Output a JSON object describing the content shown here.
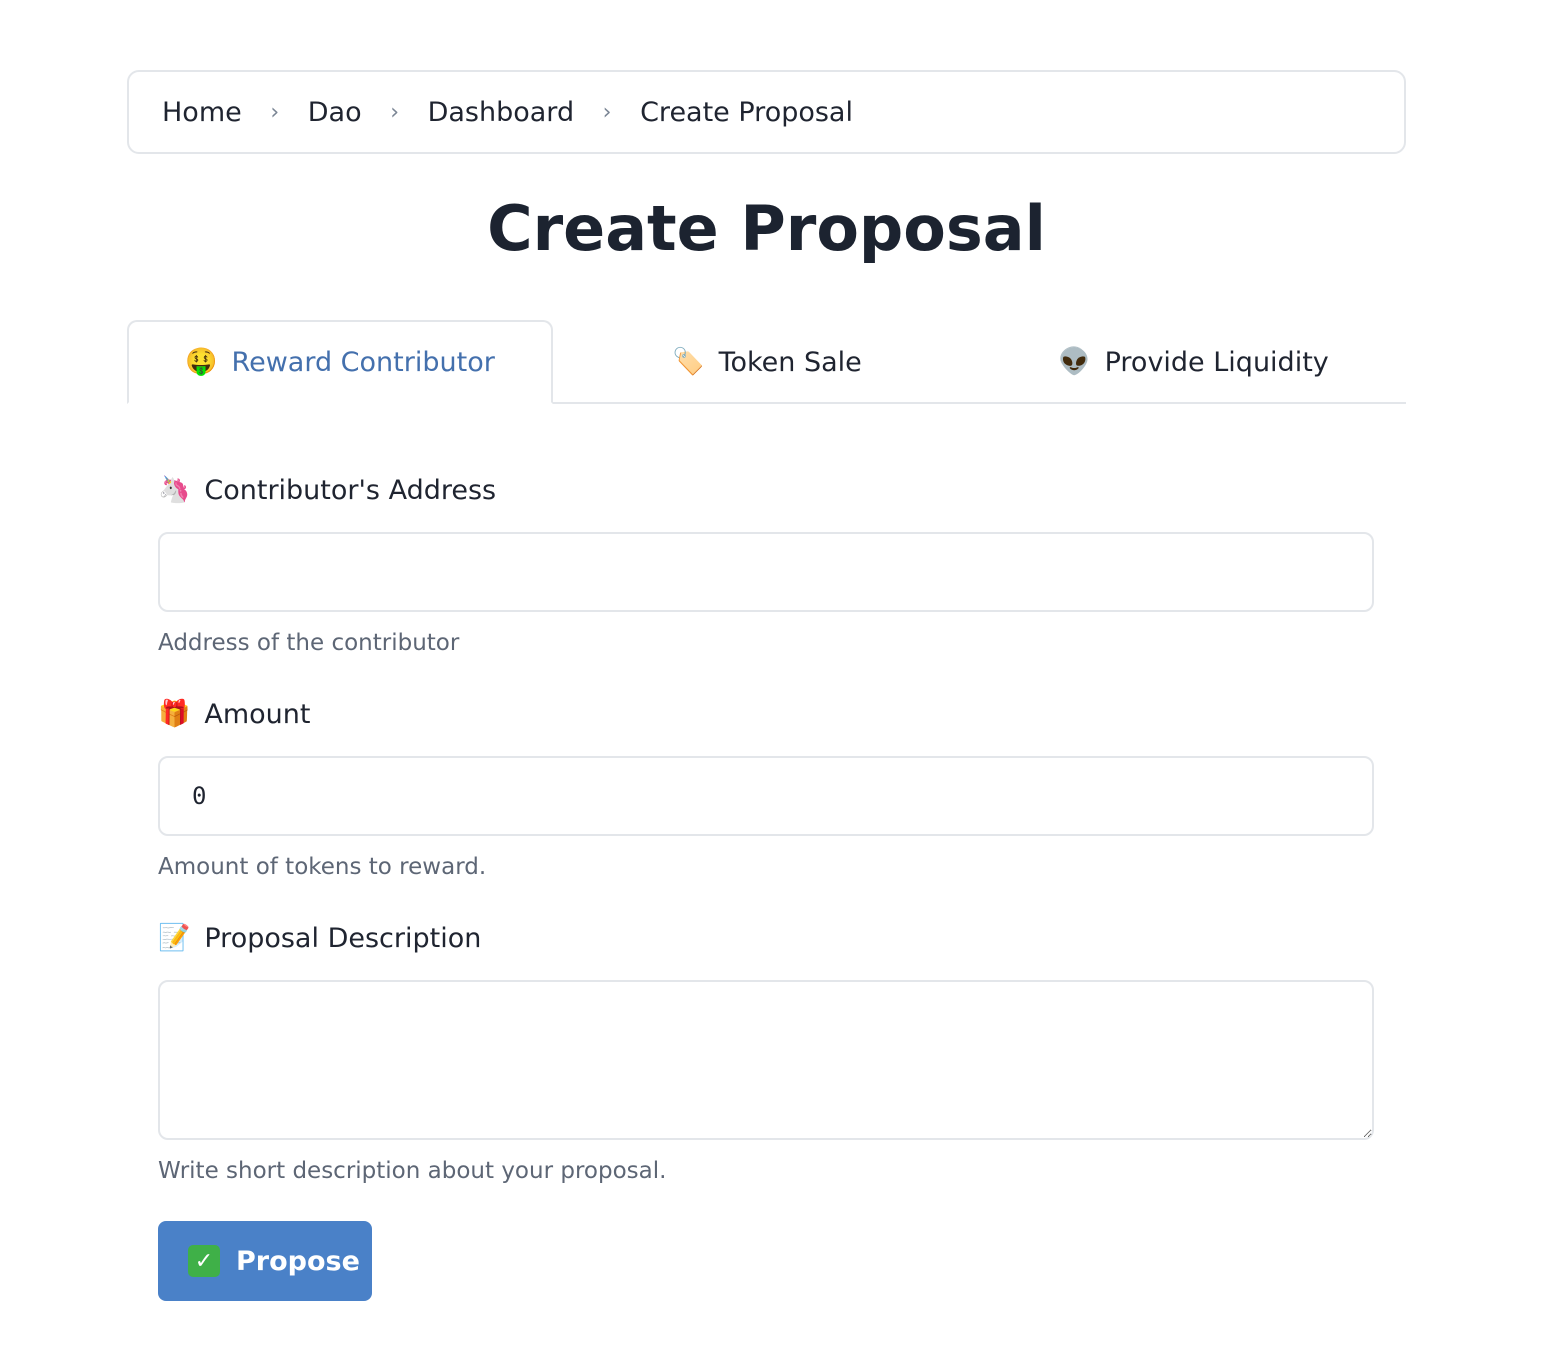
{
  "breadcrumb": {
    "items": [
      "Home",
      "Dao",
      "Dashboard",
      "Create Proposal"
    ],
    "separator": "›"
  },
  "page": {
    "title": "Create Proposal"
  },
  "tabs": [
    {
      "emoji": "🤑",
      "label": "Reward Contributor",
      "active": true
    },
    {
      "emoji": "🏷️",
      "label": "Token Sale",
      "active": false
    },
    {
      "emoji": "👽",
      "label": "Provide Liquidity",
      "active": false
    }
  ],
  "form": {
    "address": {
      "emoji": "🦄",
      "label": "Contributor's Address",
      "value": "",
      "help": "Address of the contributor"
    },
    "amount": {
      "emoji": "🎁",
      "label": "Amount",
      "value": "0",
      "help": "Amount of tokens to reward."
    },
    "description": {
      "emoji": "📝",
      "label": "Proposal Description",
      "value": "",
      "help": "Write short description about your proposal."
    },
    "submit": {
      "emoji": "✓",
      "label": "Propose"
    }
  },
  "colors": {
    "accent": "#4470ad",
    "button": "#4a81c8",
    "border": "#e3e6ea",
    "muted": "#5d6675"
  }
}
